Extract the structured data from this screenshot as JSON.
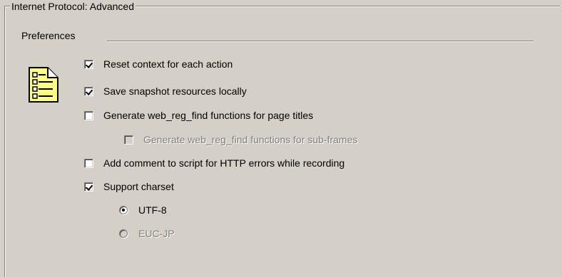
{
  "group": {
    "title": "Internet Protocol: Advanced"
  },
  "preferences": {
    "label": "Preferences",
    "icon": "notepad-list-icon",
    "options": [
      {
        "label": "Reset context for each action",
        "checked": true,
        "enabled": true
      },
      {
        "label": "Save snapshot resources locally",
        "checked": true,
        "enabled": true
      },
      {
        "label": "Generate web_reg_find functions for page titles",
        "checked": false,
        "enabled": true
      },
      {
        "label": "Generate web_reg_find functions for sub-frames",
        "checked": false,
        "enabled": false
      },
      {
        "label": "Add comment to script for HTTP errors while recording",
        "checked": false,
        "enabled": true
      },
      {
        "label": "Support charset",
        "checked": true,
        "enabled": true
      }
    ],
    "charsets": [
      {
        "label": "UTF-8",
        "selected": true,
        "enabled": true
      },
      {
        "label": "EUC-JP",
        "selected": false,
        "enabled": false
      }
    ]
  },
  "colors": {
    "background": "#d4d0c8",
    "icon_yellow": "#ffff80",
    "disabled_text": "#808080"
  }
}
